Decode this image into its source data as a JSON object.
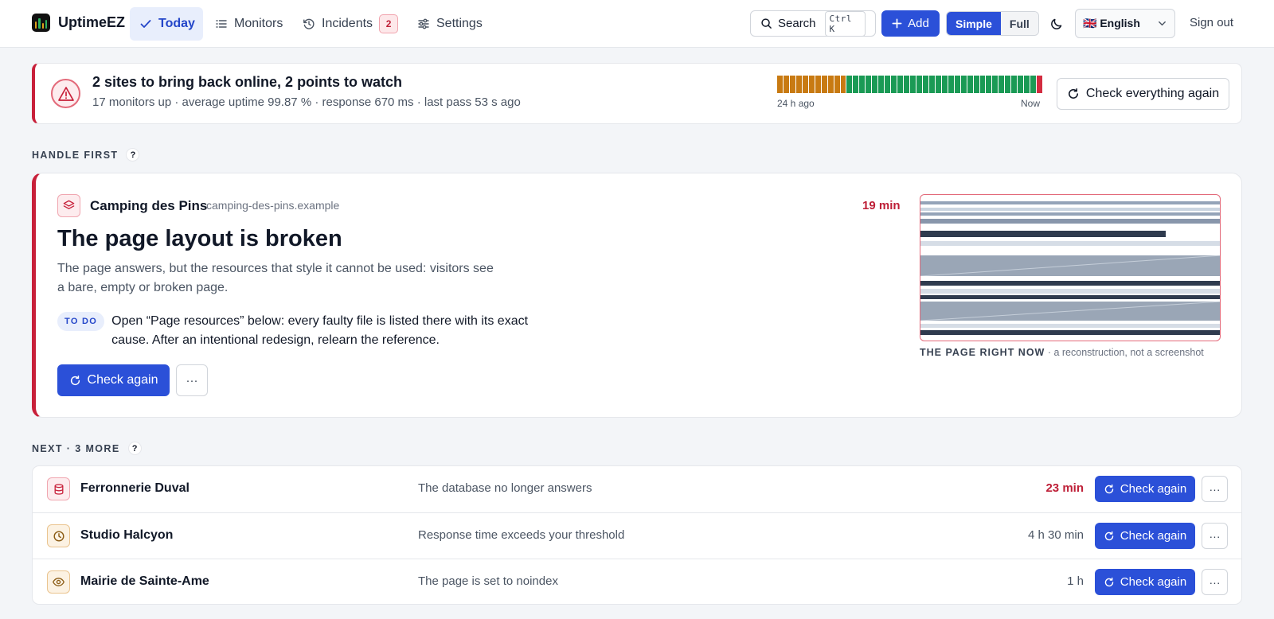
{
  "brand": {
    "name": "UptimeEZ"
  },
  "nav": [
    {
      "label": "Today",
      "icon": "check-icon",
      "active": true
    },
    {
      "label": "Monitors",
      "icon": "list-icon"
    },
    {
      "label": "Incidents",
      "icon": "history-icon",
      "badge": "2"
    },
    {
      "label": "Settings",
      "icon": "sliders-icon"
    }
  ],
  "toolbar": {
    "search_label": "Search",
    "search_shortcut": "Ctrl K",
    "add_label": "Add",
    "mode_simple": "Simple",
    "mode_full": "Full",
    "language": "🇬🇧 English",
    "sign_out": "Sign out"
  },
  "summary": {
    "title": "2 sites to bring back online, 2 points to watch",
    "subtitle": "17 monitors up · average uptime 99.87 % · response 670 ms · last pass 53 s ago",
    "history": [
      "warn",
      "warn",
      "warn",
      "warn",
      "warn",
      "warn",
      "warn",
      "warn",
      "warn",
      "warn",
      "warn",
      "up",
      "up",
      "up",
      "up",
      "up",
      "up",
      "up",
      "up",
      "up",
      "up",
      "up",
      "up",
      "up",
      "up",
      "up",
      "up",
      "up",
      "up",
      "up",
      "up",
      "up",
      "up",
      "up",
      "up",
      "up",
      "up",
      "up",
      "up",
      "up",
      "up",
      "down"
    ],
    "history_start_label": "24 h ago",
    "history_end_label": "Now",
    "check_all_label": "Check everything again",
    "colors": {
      "up": "#1a9a55",
      "warn": "#c87a12",
      "down": "#d32c40"
    }
  },
  "handle_first": {
    "section_label": "HANDLE FIRST",
    "help": "?",
    "site_name": "Camping des Pins",
    "site_host": "camping-des-pins.example",
    "duration": "19 min",
    "title": "The page layout is broken",
    "description": "The page answers, but the resources that style it cannot be used: visitors see a bare, empty or broken page.",
    "todo_label": "TO DO",
    "todo_text": "Open “Page resources” below: every faulty file is listed there with its exact cause. After an intentional redesign, relearn the reference.",
    "check_label": "Check again",
    "more_label": "···",
    "preview_caption_strong": "THE PAGE RIGHT NOW",
    "preview_caption": " · a reconstruction, not a screenshot"
  },
  "next": {
    "section_label": "NEXT · 3 MORE",
    "help": "?",
    "items": [
      {
        "name": "Ferronnerie Duval",
        "description": "The database no longer answers",
        "duration": "23 min",
        "icon": "database-icon",
        "severity": "critical",
        "check_label": "Check again",
        "more_label": "···"
      },
      {
        "name": "Studio Halcyon",
        "description": "Response time exceeds your threshold",
        "duration": "4 h 30 min",
        "icon": "clock-icon",
        "severity": "warning",
        "check_label": "Check again",
        "more_label": "···"
      },
      {
        "name": "Mairie de Sainte-Ame",
        "description": "The page is set to noindex",
        "duration": "1 h",
        "icon": "eye-icon",
        "severity": "warning",
        "check_label": "Check again",
        "more_label": "···"
      }
    ]
  }
}
